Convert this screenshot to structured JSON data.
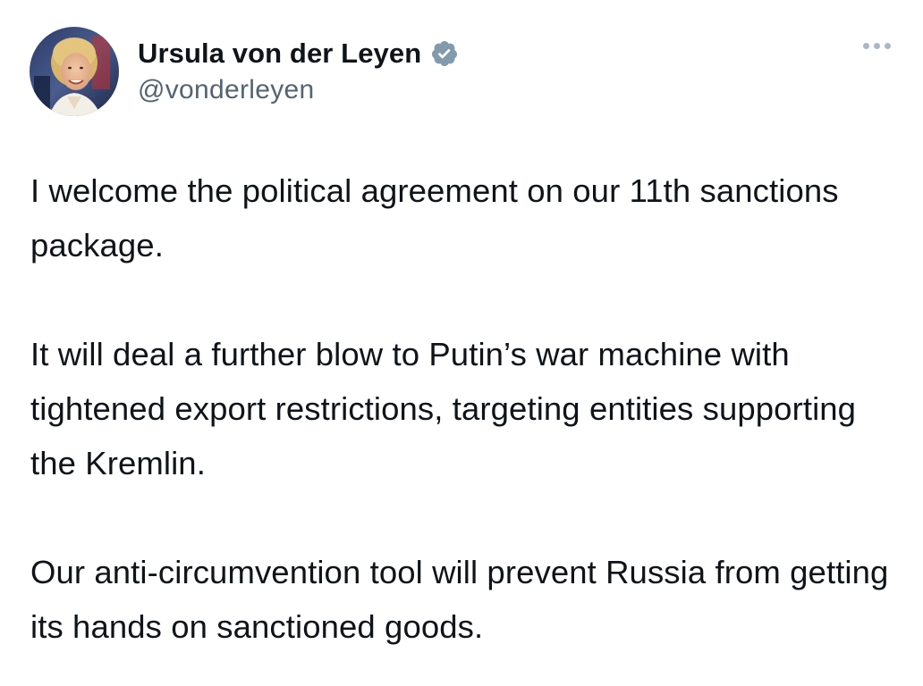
{
  "author": {
    "display_name": "Ursula von der Leyen",
    "handle": "@vonderleyen",
    "verified": true,
    "verified_color": "#829aab"
  },
  "tweet": {
    "paragraph_1": "I welcome the political agreement on our 11th sanctions package.",
    "paragraph_2": "It will deal a further blow to Putin’s war machine with tightened export restrictions, targeting entities supporting the Kremlin.",
    "paragraph_3": "Our anti-circumvention tool will prevent Russia from getting its hands on sanctioned goods."
  },
  "icons": {
    "avatar": "profile-photo",
    "verified": "verified-badge-icon",
    "more": "more-options-icon"
  }
}
